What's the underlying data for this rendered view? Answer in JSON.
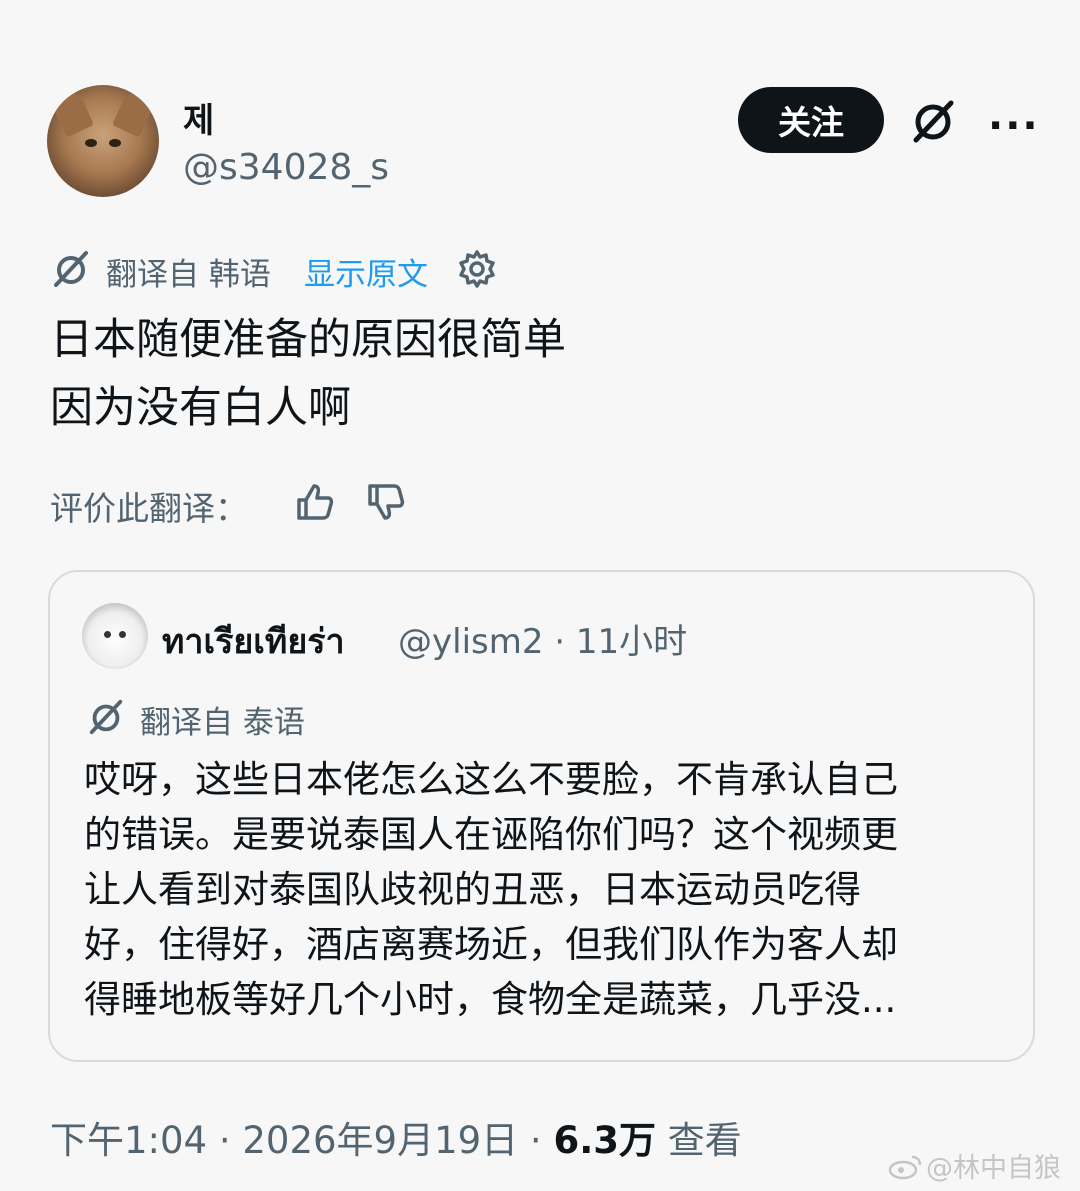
{
  "header": {
    "display_name": "제",
    "handle": "@s34028_s",
    "follow_label": "关注",
    "more_label": "···"
  },
  "translation": {
    "label": "翻译自 韩语",
    "show_original": "显示原文"
  },
  "post": {
    "text": "日本随便准备的原因很简单\n因为没有白人啊"
  },
  "rating": {
    "label": "评价此翻译："
  },
  "quote": {
    "name": "ทาเรียเทียร่า",
    "meta": "@ylism2 · 11小时",
    "translation_label": "翻译自 泰语",
    "text": "哎呀，这些日本佬怎么这么不要脸，不肯承认自己\n的错误。是要说泰国人在诬陷你们吗？这个视频更\n让人看到对泰国队歧视的丑恶，日本运动员吃得\n好，住得好，酒店离赛场近，但我们队作为客人却\n得睡地板等好几个小时，食物全是蔬菜，几乎没..."
  },
  "footer": {
    "time": "下午1:04 · 2026年9月19日 · ",
    "views": "6.3万",
    "views_label": " 查看"
  },
  "watermark": {
    "text": "@林中自狼"
  },
  "colors": {
    "background": "#f7f7f7",
    "text_primary": "#0f1419",
    "text_secondary": "#536471",
    "link": "#1d9bf0",
    "button_bg": "#0f1419"
  }
}
